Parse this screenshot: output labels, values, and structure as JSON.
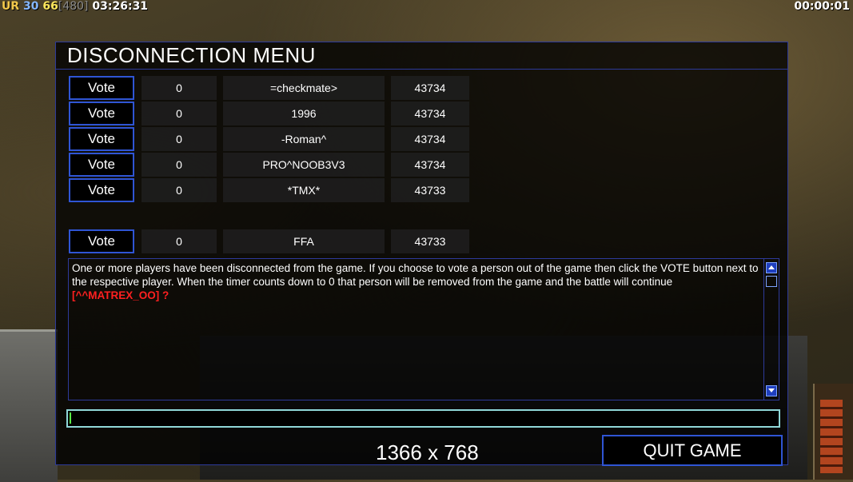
{
  "status": {
    "tag": "UR",
    "value1": "30",
    "value2": "66",
    "bracket": "[480]",
    "clock": "03:26:31",
    "timer": "00:00:01"
  },
  "dialog": {
    "title": "DISCONNECTION MENU",
    "vote_label": "Vote",
    "players": [
      {
        "count": "0",
        "name": "=checkmate>",
        "ping": "43734"
      },
      {
        "count": "0",
        "name": "1996",
        "ping": "43734"
      },
      {
        "count": "0",
        "name": "-Roman^",
        "ping": "43734"
      },
      {
        "count": "0",
        "name": "PRO^NOOB3V3",
        "ping": "43734"
      },
      {
        "count": "0",
        "name": "*TMX*",
        "ping": "43733"
      },
      {
        "count": "0",
        "name": "FFA",
        "ping": "43733"
      }
    ],
    "message": "One or more players have been disconnected from the game. If you choose to vote a person out of the game then click the VOTE button next to the respective player. When the timer counts down to 0 that person will be removed from the game and the battle will continue",
    "message_highlight": "[^^MATREX_OO] ?",
    "chat_value": "",
    "resolution": "1366 x 768",
    "quit_label": "QUIT GAME"
  }
}
